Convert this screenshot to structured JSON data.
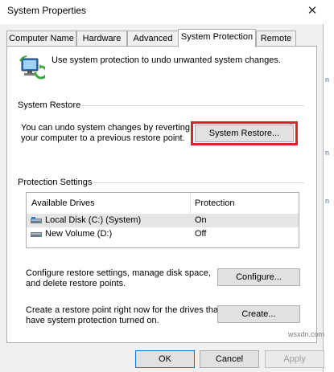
{
  "window": {
    "title": "System Properties",
    "close_glyph": "✕"
  },
  "tabs": [
    {
      "label": "Computer Name",
      "active": false
    },
    {
      "label": "Hardware",
      "active": false
    },
    {
      "label": "Advanced",
      "active": false
    },
    {
      "label": "System Protection",
      "active": true
    },
    {
      "label": "Remote",
      "active": false
    }
  ],
  "intro": {
    "icon": "system-protection-icon",
    "text": "Use system protection to undo unwanted system changes."
  },
  "system_restore": {
    "group_label": "System Restore",
    "description_line1": "You can undo system changes by reverting",
    "description_line2": "your computer to a previous restore point.",
    "button_label": "System Restore...",
    "highlight_color": "#e0202a"
  },
  "protection_settings": {
    "group_label": "Protection Settings",
    "columns": [
      "Available Drives",
      "Protection"
    ],
    "drives": [
      {
        "name": "Local Disk (C:) (System)",
        "protection": "On",
        "icon": "system-drive-icon",
        "selected": true
      },
      {
        "name": "New Volume (D:)",
        "protection": "Off",
        "icon": "drive-icon",
        "selected": false
      }
    ],
    "configure_text_line1": "Configure restore settings, manage disk space,",
    "configure_text_line2": "and delete restore points.",
    "configure_label": "Configure...",
    "create_text_line1": "Create a restore point right now for the drives that",
    "create_text_line2": "have system protection turned on.",
    "create_label": "Create..."
  },
  "footer": {
    "ok_label": "OK",
    "cancel_label": "Cancel",
    "apply_label": "Apply"
  },
  "background_window_fragments": [
    "n",
    "n",
    "n"
  ],
  "watermark": "wsxdn.com"
}
